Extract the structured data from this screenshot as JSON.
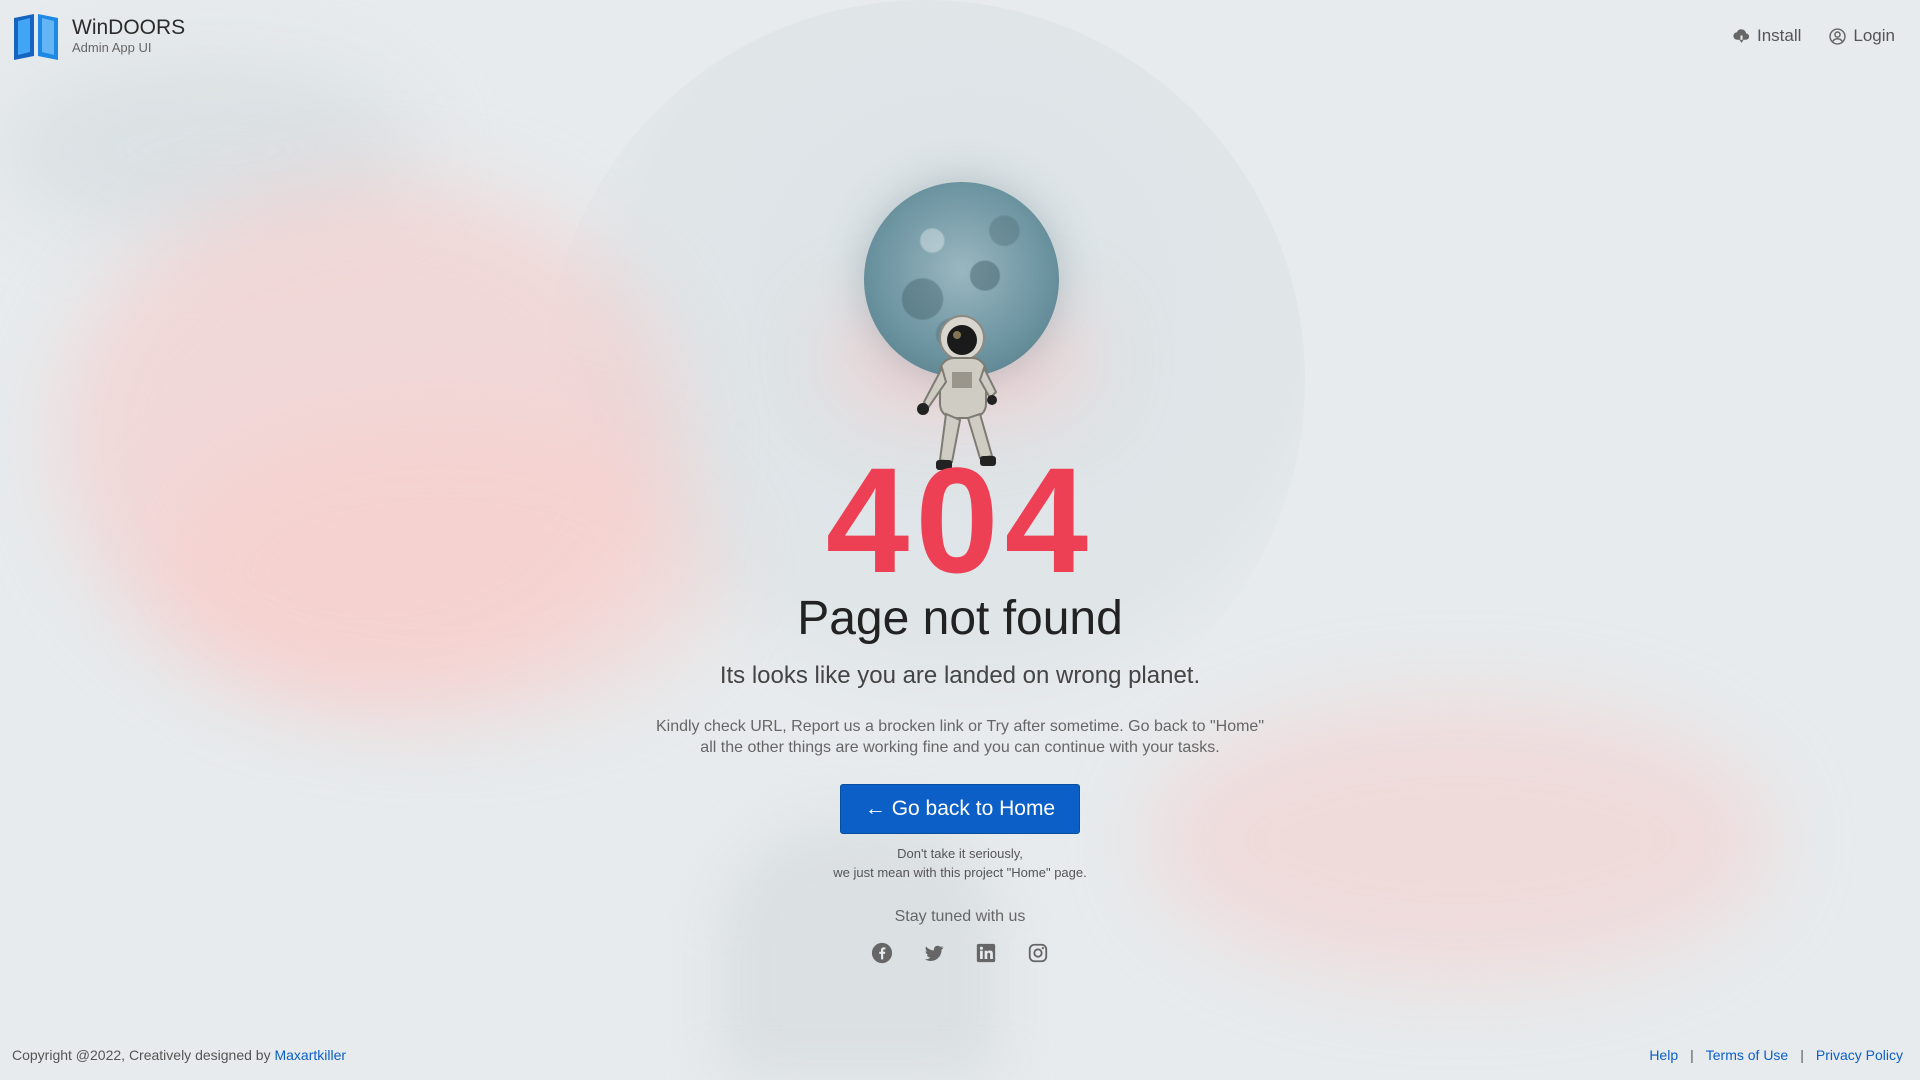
{
  "brand": {
    "name": "WinDOORS",
    "subtitle": "Admin App UI",
    "logo_icon": "book-logo-icon",
    "logo_color": "#1a73e8"
  },
  "nav": [
    {
      "label": "Install",
      "icon": "cloud-download-icon"
    },
    {
      "label": "Login",
      "icon": "user-circle-icon"
    }
  ],
  "error": {
    "code": "404",
    "title": "Page not found",
    "subtitle": "Its looks like you are landed on wrong planet.",
    "description": "Kindly check URL, Report us a brocken link or Try after sometime. Go back to \"Home\" all the other things are working fine and you can continue with your tasks.",
    "button_label": "← Go back to Home",
    "note_line1": "Don't take it seriously,",
    "note_line2": "we just mean with this project \"Home\" page.",
    "stay_tuned": "Stay tuned with us"
  },
  "social": [
    "facebook-icon",
    "twitter-icon",
    "linkedin-icon",
    "instagram-icon"
  ],
  "footer": {
    "copyright": "Copyright @2022, Creatively designed by",
    "designer": "Maxartkiller",
    "links": [
      "Help",
      "Terms of Use",
      "Privacy Policy"
    ],
    "separator": "|"
  },
  "colors": {
    "accent": "#0b5fc6",
    "error_code": "#ee4055"
  }
}
